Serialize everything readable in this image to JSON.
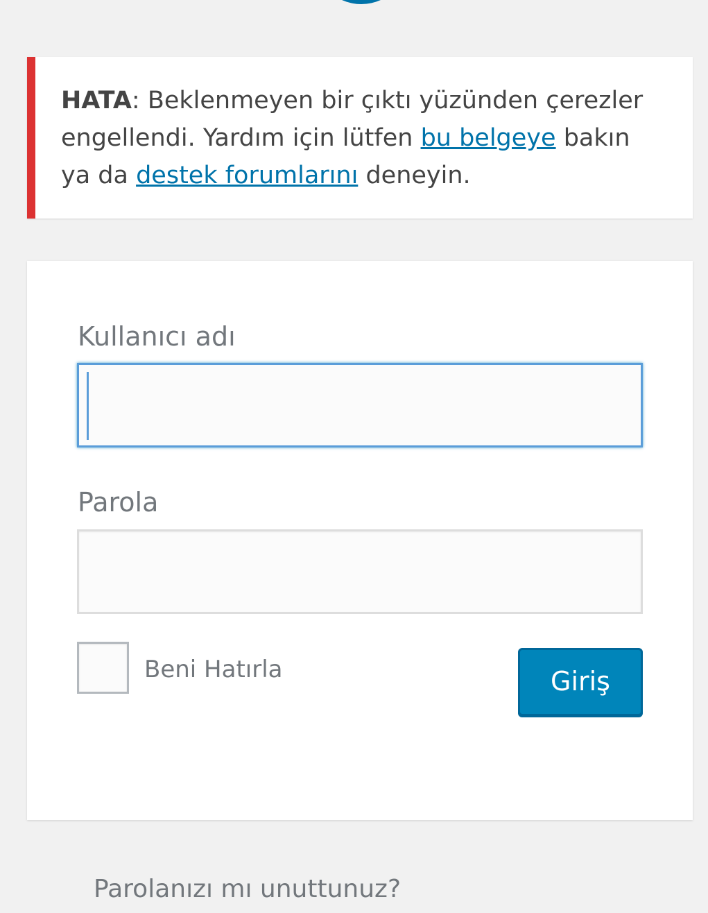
{
  "error": {
    "prefix": "HATA",
    "text_1": ": Beklenmeyen bir çıktı yüzünden çerezler engellendi. Yardım için lütfen ",
    "link_1": "bu belgeye",
    "text_2": " bakın ya da ",
    "link_2": "destek forumlarını",
    "text_3": " deneyin."
  },
  "form": {
    "username_label": "Kullanıcı adı",
    "username_value": "",
    "password_label": "Parola",
    "password_value": "",
    "remember_label": "Beni Hatırla",
    "remember_checked": false,
    "submit_label": "Giriş"
  },
  "footer": {
    "lost_password": "Parolanızı mı unuttunuz?"
  },
  "colors": {
    "background": "#f1f1f1",
    "error_border": "#dc3232",
    "link": "#0073aa",
    "button": "#0085ba",
    "focus": "#5b9dd9"
  }
}
